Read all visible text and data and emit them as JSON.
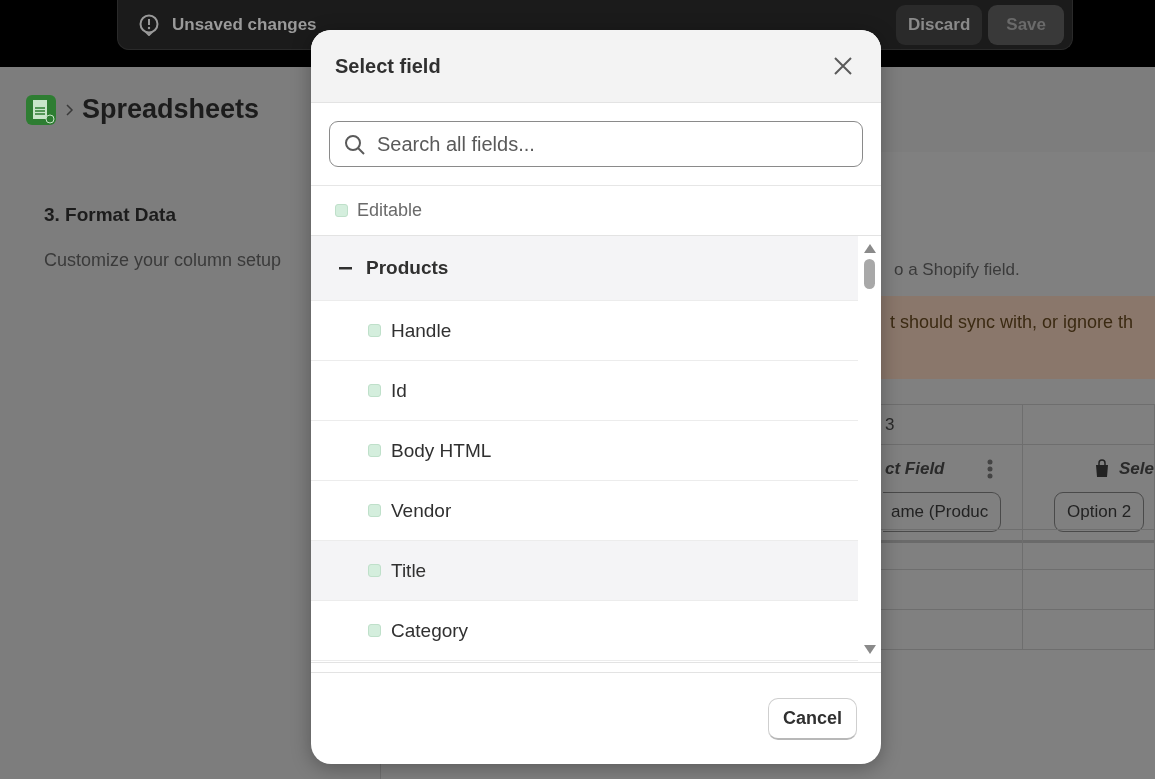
{
  "top_bar": {
    "message": "Unsaved changes",
    "buttons": [
      {
        "label": "Discard",
        "primary": false
      },
      {
        "label": "Save",
        "primary": true
      }
    ]
  },
  "page": {
    "breadcrumb": "Spreadsheets",
    "section": {
      "title": "3. Format Data",
      "description": "Customize your column setup"
    },
    "panel": {
      "hint": "o a Shopify field.",
      "warning": "t should sync with, or ignore th",
      "columns": [
        {
          "letter": "3",
          "heading": "ct Field",
          "value": "ame (Produc",
          "kind": "menu"
        },
        {
          "heading": "Sele",
          "value": "Option 2",
          "kind": "shopify"
        }
      ]
    }
  },
  "modal": {
    "title": "Select field",
    "search": {
      "placeholder": "Search all fields..."
    },
    "legend": {
      "label": "Editable"
    },
    "groups": [
      {
        "label": "Products",
        "expanded": true,
        "children": [
          {
            "label": "Handle",
            "hovered": false
          },
          {
            "label": "Id",
            "hovered": false
          },
          {
            "label": "Body HTML",
            "hovered": false
          },
          {
            "label": "Vendor",
            "hovered": false
          },
          {
            "label": "Title",
            "hovered": true
          },
          {
            "label": "Category",
            "hovered": false
          }
        ]
      }
    ],
    "cancel": "Cancel"
  }
}
